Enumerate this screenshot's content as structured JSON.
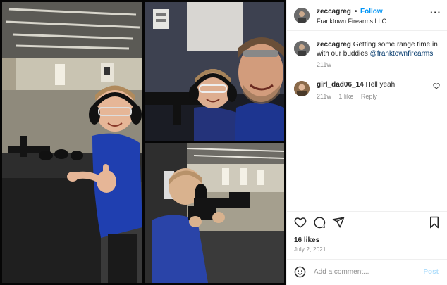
{
  "post": {
    "username": "zeccagreg",
    "separator": "•",
    "follow_label": "Follow",
    "location": "Franktown Firearms LLC",
    "more_label": "···",
    "caption": {
      "username": "zeccagreg",
      "text": "Getting some range time in with our buddies",
      "mention": "@franktownfirearms",
      "time": "211w"
    },
    "comments": [
      {
        "username": "girl_dad06_14",
        "text": "Hell yeah",
        "time": "211w",
        "likes": "1 like",
        "reply_label": "Reply"
      }
    ],
    "likes": "16 likes",
    "date": "July 2, 2021",
    "add_comment_placeholder": "Add a comment...",
    "post_label": "Post"
  },
  "icons": {
    "like": "heart-icon",
    "comment": "comment-icon",
    "share": "paper-plane-icon",
    "save": "bookmark-icon",
    "emoji": "smiley-icon",
    "comment_like": "heart-outline-icon"
  },
  "colors": {
    "follow": "#0095f6",
    "mention": "#00376b",
    "meta": "#8e8e8e",
    "post_disabled": "#b2dffc"
  }
}
